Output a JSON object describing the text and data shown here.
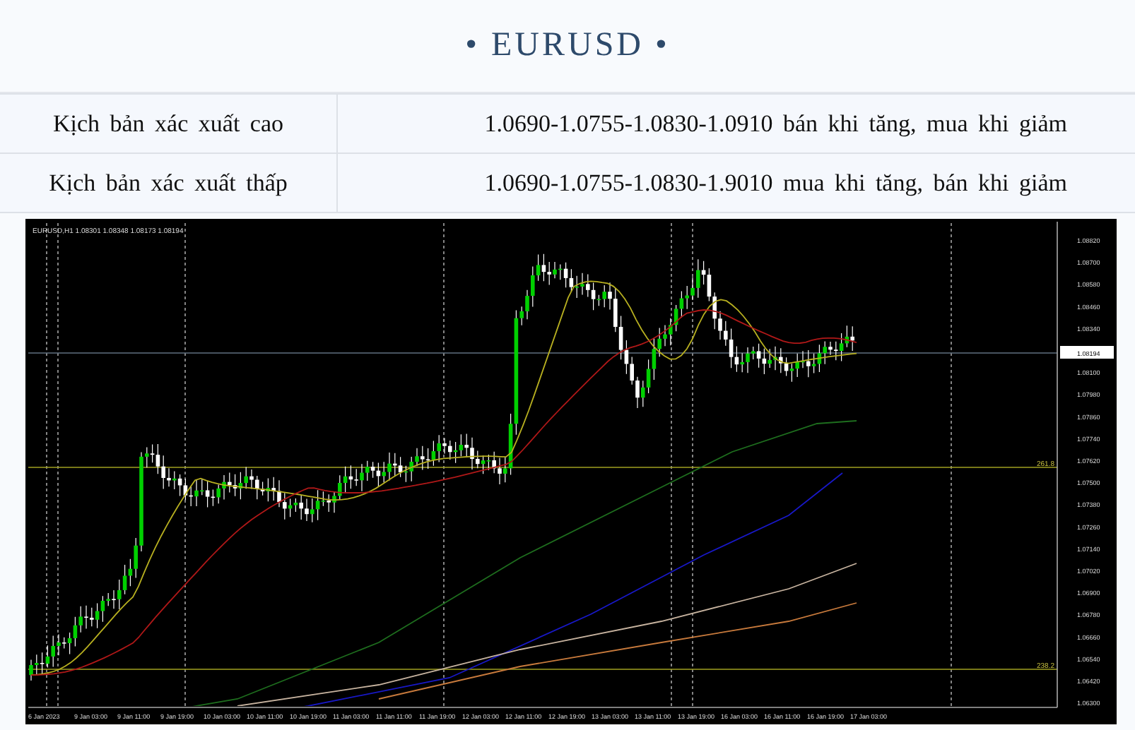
{
  "title": "• EURUSD •",
  "scenarios": [
    {
      "label": "Kịch bản xác xuất cao",
      "value": "1.0690-1.0755-1.0830-1.0910 bán khi tăng, mua khi giảm"
    },
    {
      "label": "Kịch bản xác xuất thấp",
      "value": "1.0690-1.0755-1.0830-1.9010 mua khi tăng, bán khi giảm"
    }
  ],
  "chart": {
    "header": "EURUSD,H1  1.08301 1.08348 1.08173 1.08194",
    "price_labels": [
      "1.08820",
      "1.08700",
      "1.08580",
      "1.08460",
      "1.08340",
      "1.08100",
      "1.07980",
      "1.07860",
      "1.07740",
      "1.07620",
      "1.07500",
      "1.07380",
      "1.07260",
      "1.07140",
      "1.07020",
      "1.06900",
      "1.06780",
      "1.06660",
      "1.06540",
      "1.06420",
      "1.06300"
    ],
    "current_price": "1.08194",
    "levels": [
      {
        "label": "261.8"
      },
      {
        "label": "238.2"
      }
    ],
    "time_labels": [
      "6 Jan 2023",
      "9 Jan 03:00",
      "9 Jan 11:00",
      "9 Jan 19:00",
      "10 Jan 03:00",
      "10 Jan 11:00",
      "10 Jan 19:00",
      "11 Jan 03:00",
      "11 Jan 11:00",
      "11 Jan 19:00",
      "12 Jan 03:00",
      "12 Jan 11:00",
      "12 Jan 19:00",
      "13 Jan 03:00",
      "13 Jan 11:00",
      "13 Jan 19:00",
      "16 Jan 03:00",
      "16 Jan 11:00",
      "16 Jan 19:00",
      "17 Jan 03:00"
    ]
  }
}
